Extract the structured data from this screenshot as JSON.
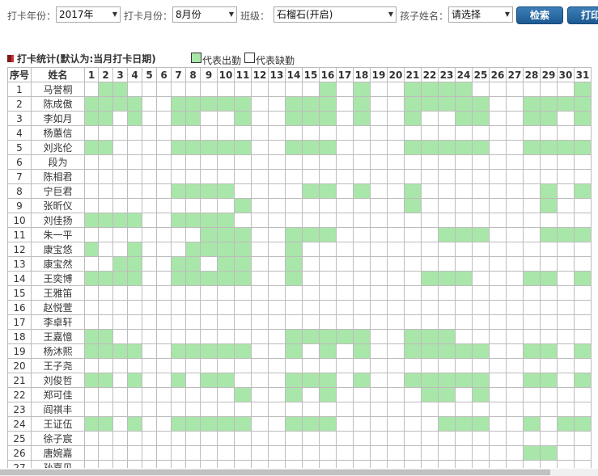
{
  "filters": {
    "year_label": "打卡年份：",
    "year_value": "2017年",
    "month_label": "打卡月份：",
    "month_value": "8月份",
    "class_label": "班级：",
    "class_value": "石榴石(开启)",
    "child_label": "孩子姓名：",
    "child_value": "请选择",
    "search_button": "检索",
    "print_button": "打印"
  },
  "section": {
    "title": "打卡统计(默认为:当月打卡日期)",
    "legend_present": "代表出勤",
    "legend_absent": "代表缺勤",
    "present_color": "#a9e6a9"
  },
  "table": {
    "col_index": "序号",
    "col_name": "姓名",
    "days": [
      "1",
      "2",
      "3",
      "4",
      "5",
      "6",
      "7",
      "8",
      "9",
      "10",
      "11",
      "12",
      "13",
      "14",
      "15",
      "16",
      "17",
      "18",
      "19",
      "20",
      "21",
      "22",
      "23",
      "24",
      "25",
      "26",
      "27",
      "28",
      "29",
      "30",
      "31"
    ],
    "rows": [
      {
        "index": "1",
        "name": "马誉桐",
        "present": [
          2,
          3,
          16,
          18,
          21,
          22,
          23,
          24,
          31
        ]
      },
      {
        "index": "2",
        "name": "陈成傲",
        "present": [
          1,
          2,
          3,
          4,
          7,
          8,
          9,
          10,
          11,
          14,
          15,
          16,
          18,
          21,
          22,
          23,
          24,
          25,
          28,
          29,
          30,
          31
        ]
      },
      {
        "index": "3",
        "name": "李如月",
        "present": [
          1,
          2,
          4,
          7,
          8,
          11,
          14,
          15,
          16,
          18,
          21,
          24,
          25,
          28,
          29,
          31
        ]
      },
      {
        "index": "4",
        "name": "杨蕙信",
        "present": []
      },
      {
        "index": "5",
        "name": "刘兆伦",
        "present": [
          1,
          2,
          7,
          8,
          9,
          10,
          11,
          14,
          15,
          16,
          21,
          22,
          23,
          24,
          25,
          28,
          29,
          30,
          31
        ]
      },
      {
        "index": "6",
        "name": "段为",
        "present": []
      },
      {
        "index": "7",
        "name": "陈相君",
        "present": []
      },
      {
        "index": "8",
        "name": "宁巨君",
        "present": [
          7,
          8,
          9,
          10,
          15,
          16,
          18,
          21,
          29,
          31
        ]
      },
      {
        "index": "9",
        "name": "张昕仪",
        "present": [
          11,
          21,
          29
        ]
      },
      {
        "index": "10",
        "name": "刘佳扬",
        "present": [
          1,
          2,
          3,
          4,
          7,
          8,
          9,
          10
        ]
      },
      {
        "index": "11",
        "name": "朱一平",
        "present": [
          9,
          10,
          11,
          14,
          15,
          16,
          23,
          24,
          25,
          29,
          30,
          31
        ]
      },
      {
        "index": "12",
        "name": "康宝悠",
        "present": [
          1,
          4,
          8,
          9,
          10,
          11,
          14
        ]
      },
      {
        "index": "13",
        "name": "康宝然",
        "present": [
          3,
          4,
          7,
          8,
          10,
          11,
          14
        ]
      },
      {
        "index": "14",
        "name": "王奕博",
        "present": [
          1,
          2,
          3,
          4,
          7,
          8,
          9,
          10,
          11,
          14,
          22,
          23,
          24,
          28,
          29,
          31
        ]
      },
      {
        "index": "15",
        "name": "王雅笛",
        "present": []
      },
      {
        "index": "16",
        "name": "赵悦萱",
        "present": []
      },
      {
        "index": "17",
        "name": "李卓轩",
        "present": []
      },
      {
        "index": "18",
        "name": "王嘉憶",
        "present": [
          1,
          2,
          14,
          15,
          16,
          17,
          18,
          21,
          22,
          23
        ]
      },
      {
        "index": "19",
        "name": "杨沐熙",
        "present": [
          1,
          2,
          3,
          4,
          7,
          8,
          9,
          10,
          11,
          14,
          16,
          18,
          21,
          22,
          23,
          24,
          25,
          28,
          29,
          31
        ]
      },
      {
        "index": "20",
        "name": "王子尧",
        "present": []
      },
      {
        "index": "21",
        "name": "刘俊哲",
        "present": [
          1,
          2,
          4,
          7,
          9,
          10,
          14,
          15,
          16,
          18,
          21,
          22,
          23,
          24,
          25,
          28,
          29,
          31
        ]
      },
      {
        "index": "22",
        "name": "郑可佳",
        "present": [
          11,
          14,
          16,
          22,
          23,
          25
        ]
      },
      {
        "index": "23",
        "name": "阎祺丰",
        "present": []
      },
      {
        "index": "24",
        "name": "王证伍",
        "present": [
          1,
          2,
          4,
          7,
          8,
          9,
          10,
          11,
          14,
          15,
          16,
          23,
          24,
          25,
          28,
          30,
          31
        ]
      },
      {
        "index": "25",
        "name": "徐子宸",
        "present": []
      },
      {
        "index": "26",
        "name": "唐婉嘉",
        "present": [
          28,
          29
        ]
      },
      {
        "index": "27",
        "name": "孙嘉贝",
        "present": []
      }
    ]
  }
}
